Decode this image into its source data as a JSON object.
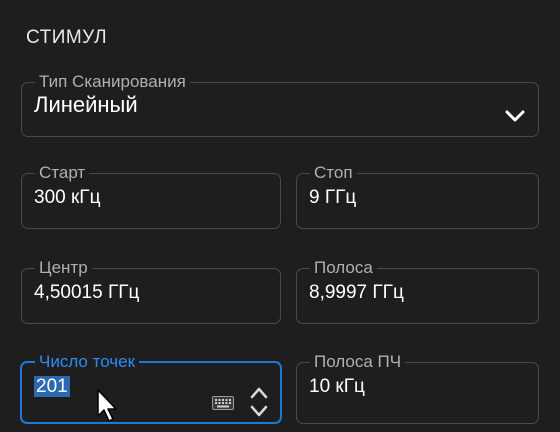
{
  "section": {
    "title": "СТИМУЛ"
  },
  "scan_type": {
    "label": "Тип Сканирования",
    "value": "Линейный"
  },
  "start": {
    "label": "Старт",
    "value": "300 кГц"
  },
  "stop": {
    "label": "Стоп",
    "value": "9 ГГц"
  },
  "center": {
    "label": "Центр",
    "value": "4,50015 ГГц"
  },
  "span": {
    "label": "Полоса",
    "value": "8,9997 ГГц"
  },
  "points": {
    "label": "Число точек",
    "value": "201"
  },
  "if_bandwidth": {
    "label": "Полоса ПЧ",
    "value": "10 кГц"
  },
  "icons": [
    "chevron-down-icon",
    "keyboard-icon",
    "stepper-icon",
    "mouse-cursor-icon"
  ],
  "colors": {
    "background": "#1e1e1e",
    "accent": "#1e78d6",
    "border": "#4a4a4a",
    "selection": "#2b6ab0"
  }
}
